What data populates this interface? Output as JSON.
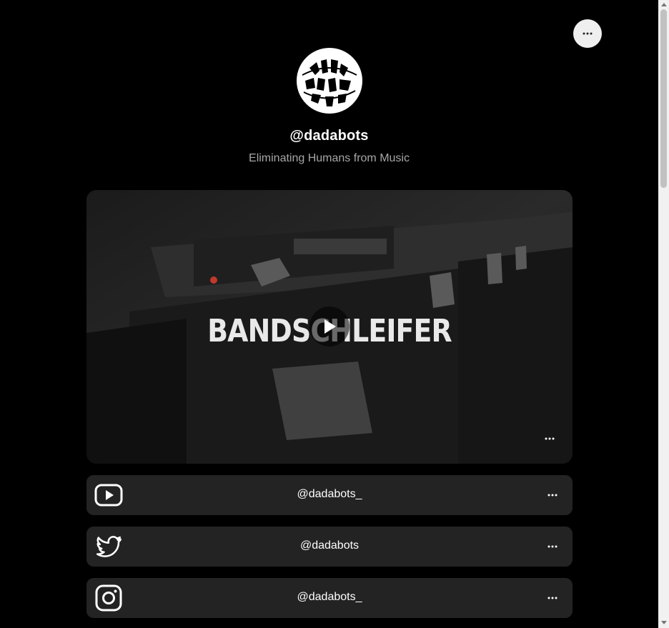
{
  "profile": {
    "handle": "@dadabots",
    "bio": "Eliminating Humans from Music",
    "avatar_icon": "dadabots-logo"
  },
  "top_more_icon": "more-horizontal-icon",
  "video": {
    "title": "BANDSCHLEIFER",
    "play_icon": "play-icon",
    "more_icon": "more-horizontal-icon"
  },
  "links": [
    {
      "icon": "youtube-icon",
      "label": "@dadabots_"
    },
    {
      "icon": "twitter-icon",
      "label": "@dadabots"
    },
    {
      "icon": "instagram-icon",
      "label": "@dadabots_"
    }
  ],
  "colors": {
    "background": "#000000",
    "card": "#232323",
    "muted_text": "#a6a6a6",
    "button_bg": "#efefef"
  }
}
